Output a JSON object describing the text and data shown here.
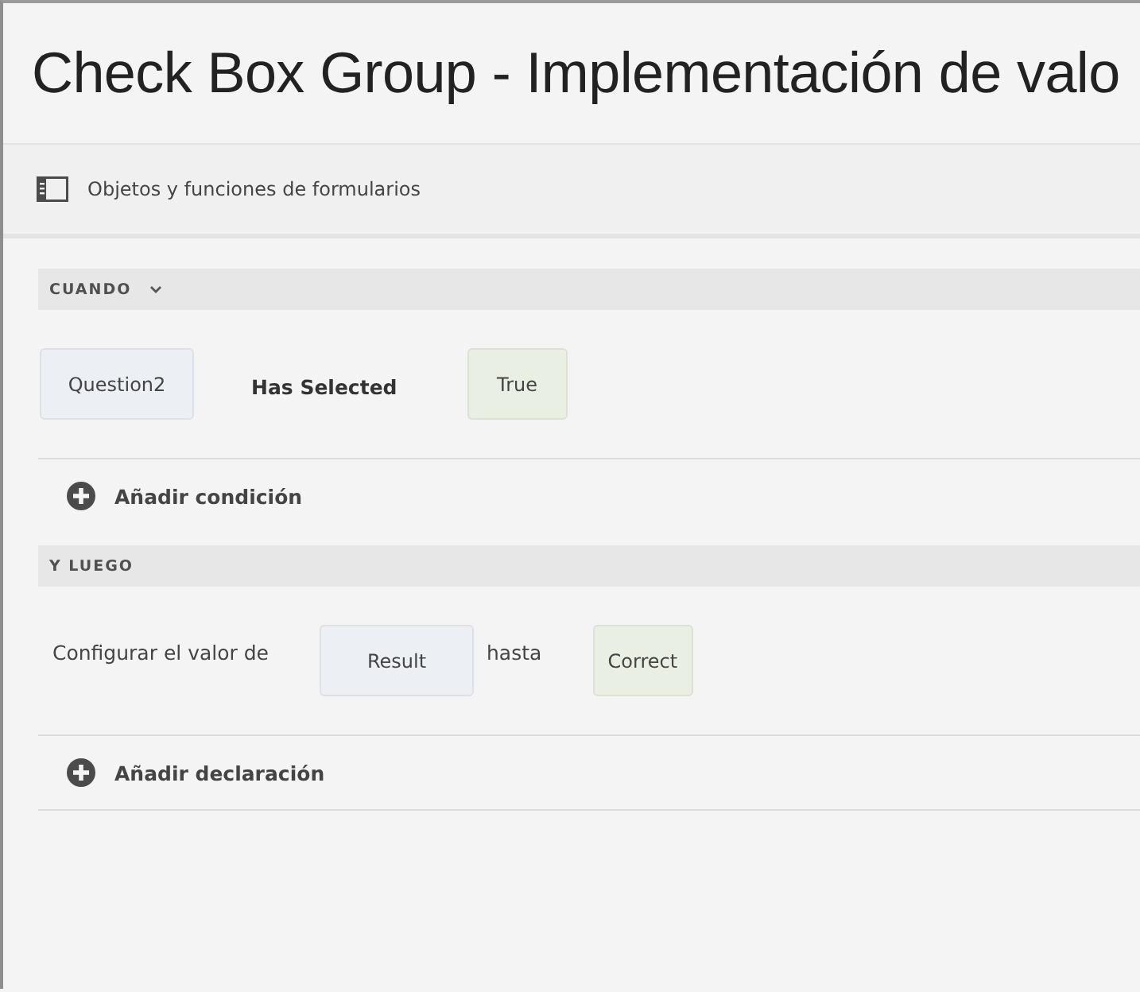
{
  "window": {
    "title": "Check Box Group - Implementación de valo"
  },
  "toolbar": {
    "label": "Objetos y funciones de formularios"
  },
  "sections": [
    {
      "heading": "CUANDO",
      "expanded": true,
      "tokens": [
        {
          "kind": "field",
          "text": "Question2"
        },
        {
          "kind": "operator",
          "text": "Has Selected"
        },
        {
          "kind": "value",
          "text": "True"
        }
      ],
      "add_label": "Añadir condición"
    },
    {
      "heading": "Y LUEGO",
      "tokens": [
        {
          "kind": "text",
          "text": "Configurar el valor de"
        },
        {
          "kind": "field",
          "text": "Result"
        },
        {
          "kind": "text",
          "text": "hasta"
        },
        {
          "kind": "value",
          "text": "Correct"
        }
      ],
      "add_label": "Añadir declaración"
    }
  ]
}
